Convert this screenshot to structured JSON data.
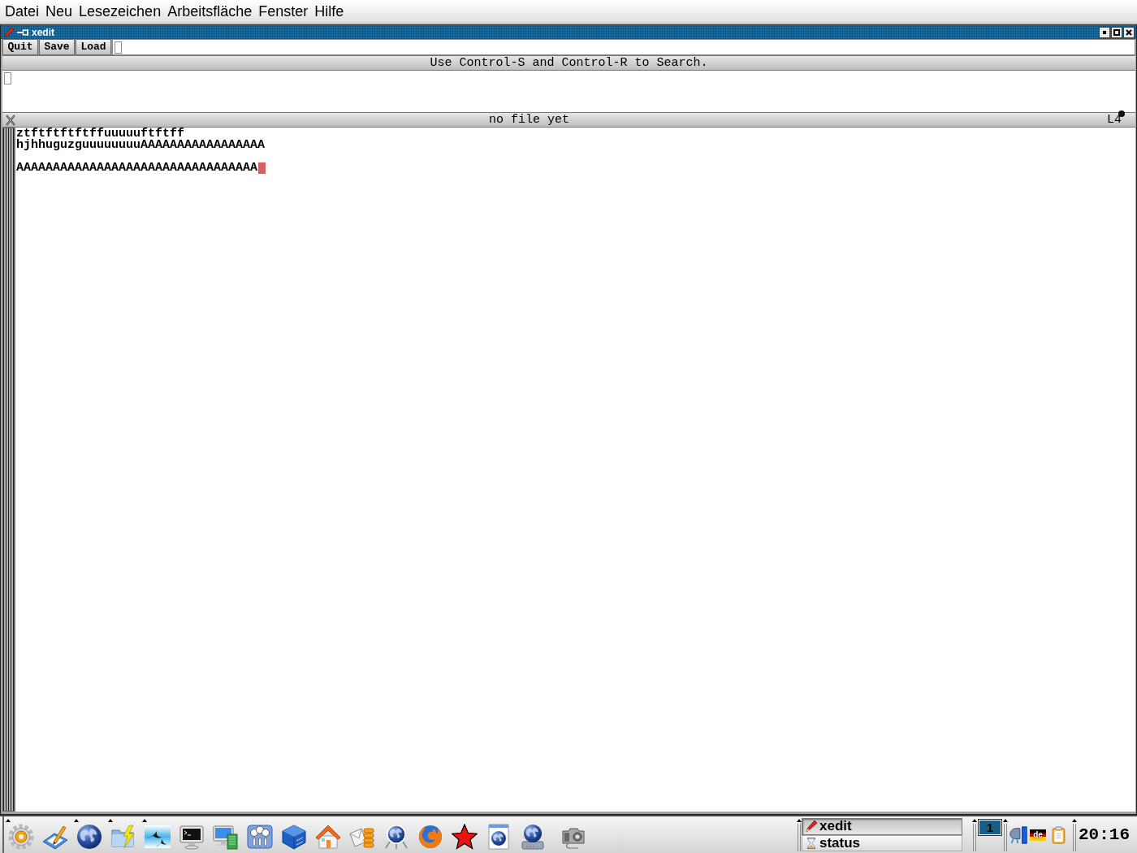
{
  "menu_bar": [
    "Datei",
    "Neu",
    "Lesezeichen",
    "Arbeitsfläche",
    "Fenster",
    "Hilfe"
  ],
  "window": {
    "title": "xedit"
  },
  "buttons": [
    "Quit",
    "Save",
    "Load"
  ],
  "message": "Use Control-S and Control-R to Search.",
  "status_bar": {
    "file": "no file yet",
    "line": "L4"
  },
  "editor": {
    "text": "ztftftftftffuuuuuftftff\nhjhhuguzguuuuuuuuAAAAAAAAAAAAAAAAA\n\nAAAAAAAAAAAAAAAAAAAAAAAAAAAAAAAAA"
  },
  "taskbar": {
    "tasks": [
      {
        "label": "xedit",
        "selected": true
      },
      {
        "label": "status",
        "selected": false
      }
    ],
    "pager": [
      {
        "label": "1",
        "selected": true
      }
    ],
    "keyboard_layout": "de",
    "clock": "20:16"
  }
}
